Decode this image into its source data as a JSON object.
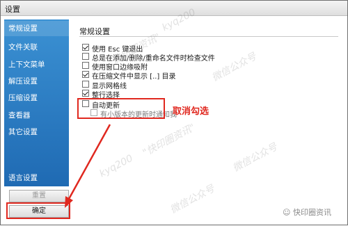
{
  "window": {
    "title": "设置"
  },
  "sidebar": {
    "items": [
      {
        "label": "常规设置",
        "selected": true
      },
      {
        "label": "文件关联"
      },
      {
        "label": "上下文菜单"
      },
      {
        "label": "解压设置"
      },
      {
        "label": "压缩设置"
      },
      {
        "label": "查看器"
      },
      {
        "label": "其它设置"
      },
      {
        "label": "语言设置"
      }
    ]
  },
  "main": {
    "section_title": "常规设置",
    "options": [
      {
        "label": "使用 Esc 键退出",
        "checked": true
      },
      {
        "label": "总是在添加/删除/重命名文件时检查文件",
        "checked": false
      },
      {
        "label": "使用窗口边缘吸附",
        "checked": false
      },
      {
        "label": "在压缩文件中显示 [..] 目录",
        "checked": true
      },
      {
        "label": "显示网格线",
        "checked": false
      },
      {
        "label": "整行选择",
        "checked": true
      },
      {
        "label": "自动更新",
        "checked": false
      },
      {
        "label": "有小版本的更新时通知我",
        "checked": false,
        "disabled": true
      }
    ]
  },
  "annotation": {
    "text": "取消勾选",
    "color": "#e0281f"
  },
  "buttons": {
    "reset": "重置",
    "ok": "确定"
  },
  "watermark": {
    "texts": [
      "\"快印圈资讯\"",
      "kyq200",
      "微信公众号"
    ],
    "logo_text": "快印圈资讯"
  },
  "colors": {
    "sidebar": "#2a7cc4",
    "highlight": "#e0281f"
  }
}
